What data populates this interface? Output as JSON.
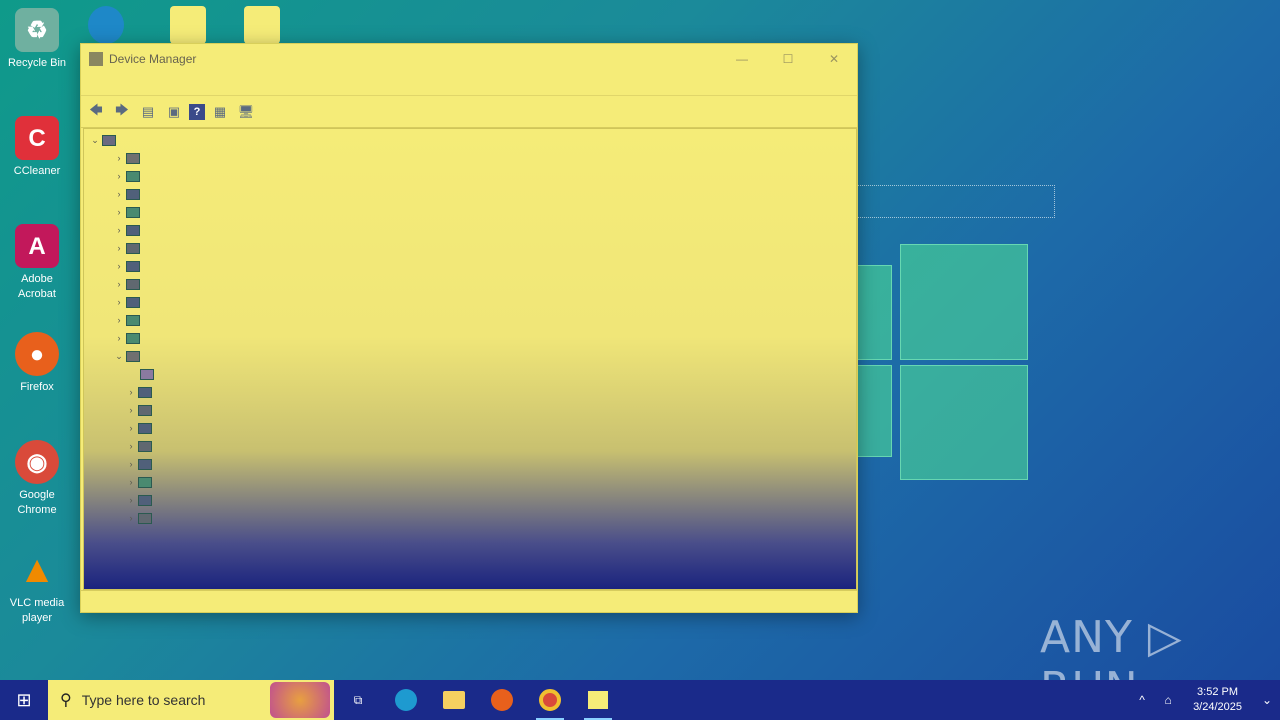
{
  "desktop": {
    "icons": [
      {
        "label": "Recycle Bin",
        "glyph": "♻",
        "color": "#6fb0a0"
      },
      {
        "label": "CCleaner",
        "glyph": "C",
        "color": "#e0303a"
      },
      {
        "label": "Adobe Acrobat",
        "glyph": "A",
        "color": "#c2185b"
      },
      {
        "label": "Firefox",
        "glyph": "●",
        "color": "#e8601c"
      },
      {
        "label": "Google Chrome",
        "glyph": "◉",
        "color": "#d94a3a"
      },
      {
        "label": "VLC media player",
        "glyph": "▲",
        "color": "#f08a00"
      }
    ]
  },
  "window": {
    "title": "Device Manager",
    "minimize": "—",
    "maximize": "☐",
    "close": "✕",
    "toolbar": {
      "back": "🡄",
      "forward": "🡆",
      "properties": "▤",
      "update": "▣",
      "help": "?",
      "view": "▦",
      "monitor": "🖥"
    }
  },
  "watermark": "ANY ▷ RUN",
  "taskbar": {
    "start": "⊞",
    "search_placeholder": "Type here to search",
    "search_icon": "⚲",
    "apps": [
      "task-view",
      "edge",
      "file-explorer",
      "firefox",
      "chrome",
      "device-manager"
    ],
    "tray": {
      "chevron": "^",
      "network": "⌂",
      "time": "3:52 PM",
      "date": "3/24/2025",
      "show_desktop": "⌄"
    }
  }
}
